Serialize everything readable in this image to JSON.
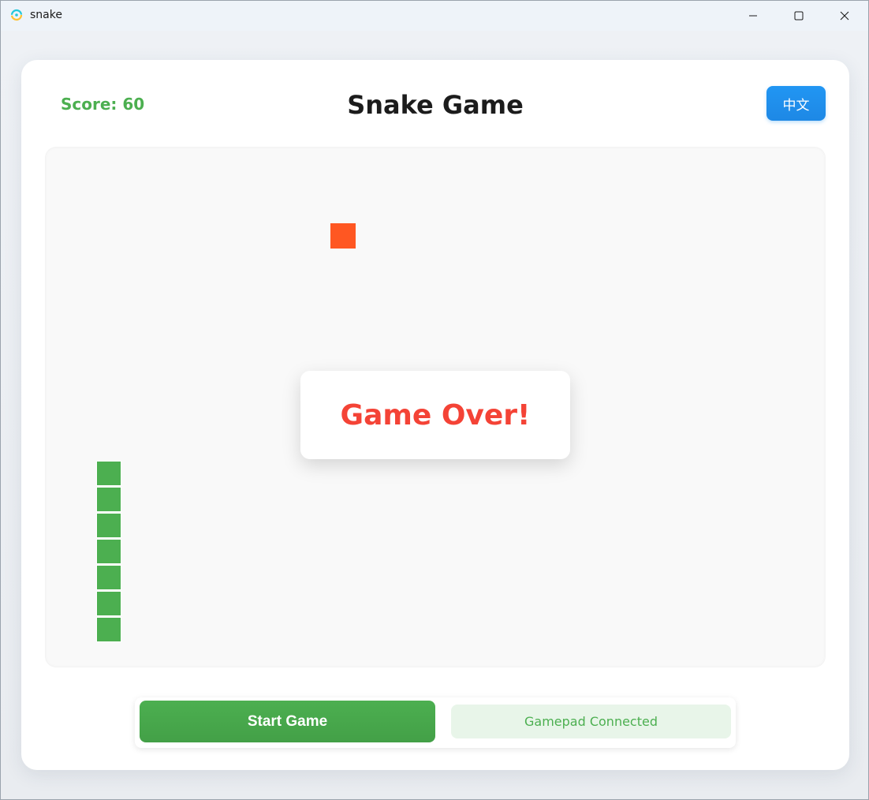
{
  "window": {
    "title": "snake"
  },
  "header": {
    "score_text": "Score: 60",
    "title": "Snake Game",
    "language_button": "中文"
  },
  "board": {
    "grid_cell": 33,
    "food": {
      "col": 11,
      "row": 3,
      "color": "#ff5722"
    },
    "snake": [
      {
        "col": 2,
        "row": 13
      },
      {
        "col": 2,
        "row": 14
      },
      {
        "col": 2,
        "row": 15
      },
      {
        "col": 2,
        "row": 16
      },
      {
        "col": 2,
        "row": 17
      },
      {
        "col": 2,
        "row": 18
      },
      {
        "col": 2,
        "row": 19
      }
    ],
    "snake_color": "#4caf50"
  },
  "overlay": {
    "message": "Game Over!"
  },
  "controls": {
    "start_label": "Start Game",
    "gamepad_status": "Gamepad Connected"
  },
  "colors": {
    "accent_green": "#4caf50",
    "accent_blue": "#2196f3",
    "danger_red": "#f44336"
  }
}
